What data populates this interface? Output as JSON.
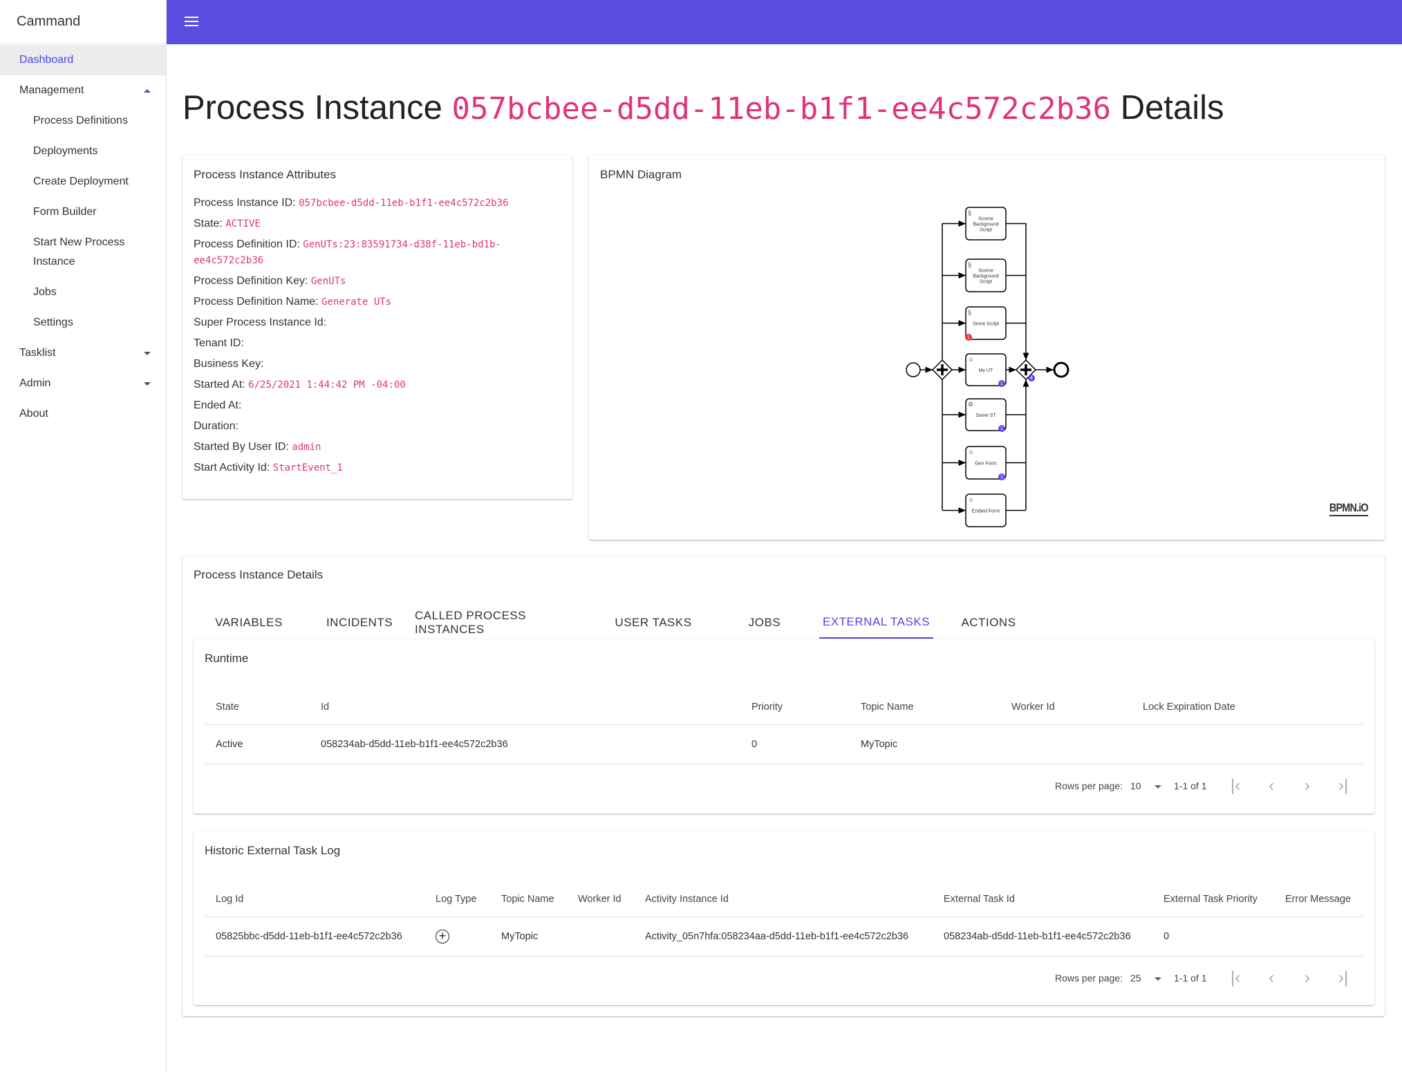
{
  "app": {
    "name": "Cammand",
    "header_color": "#5b4de0",
    "accent": "#4f46e5",
    "value_color": "#e0337a"
  },
  "sidebar": {
    "items": [
      {
        "label": "Dashboard",
        "active": true
      },
      {
        "label": "Management",
        "expanded": true
      },
      {
        "label": "Process Definitions"
      },
      {
        "label": "Deployments"
      },
      {
        "label": "Create Deployment"
      },
      {
        "label": "Form Builder"
      },
      {
        "label": "Start New Process"
      },
      {
        "label": "Instance"
      },
      {
        "label": "Jobs"
      },
      {
        "label": "Settings"
      },
      {
        "label": "Tasklist",
        "expanded": false
      },
      {
        "label": "Admin",
        "expanded": false
      },
      {
        "label": "About"
      }
    ]
  },
  "page": {
    "title_prefix": "Process Instance ",
    "title_id": "057bcbee-d5dd-11eb-b1f1-ee4c572c2b36",
    "title_suffix": " Details"
  },
  "attributes": {
    "title": "Process Instance Attributes",
    "rows": [
      {
        "label": "Process Instance ID: ",
        "value": "057bcbee-d5dd-11eb-b1f1-ee4c572c2b36"
      },
      {
        "label": "State: ",
        "value": "ACTIVE"
      },
      {
        "label": "Process Definition ID: ",
        "value": "GenUTs:23:83591734-d38f-11eb-bd1b-"
      },
      {
        "label": "",
        "value": "ee4c572c2b36"
      },
      {
        "label": "Process Definition Key: ",
        "value": "GenUTs"
      },
      {
        "label": "Process Definition Name: ",
        "value": "Generate UTs"
      },
      {
        "label": "Super Process Instance Id:",
        "value": ""
      },
      {
        "label": "Tenant ID:",
        "value": ""
      },
      {
        "label": "Business Key:",
        "value": ""
      },
      {
        "label": "Started At: ",
        "value": "6/25/2021 1:44:42 PM -04:00"
      },
      {
        "label": "Ended At:",
        "value": ""
      },
      {
        "label": "Duration:",
        "value": ""
      },
      {
        "label": "Started By User ID: ",
        "value": "admin"
      },
      {
        "label": "Start Activity Id: ",
        "value": "StartEvent_1"
      }
    ]
  },
  "bpmn": {
    "title": "BPMN Diagram",
    "logo": "BPMN.iO",
    "tasks": [
      {
        "name": "Scome Background Script",
        "type": "script"
      },
      {
        "name": "Scome Background Script",
        "type": "script"
      },
      {
        "name": "Some Script",
        "type": "script",
        "incident_badge": "1"
      },
      {
        "name": "My UT",
        "type": "user",
        "badge": "1"
      },
      {
        "name": "Some ST",
        "type": "service",
        "badge": "1"
      },
      {
        "name": "Gen Form",
        "type": "user",
        "badge": "1"
      },
      {
        "name": "Embed Form",
        "type": "user"
      }
    ],
    "join_badge": "4",
    "badge_color": "#5b4de0",
    "incident_color": "#e53935"
  },
  "details": {
    "title": "Process Instance Details",
    "tabs": [
      "VARIABLES",
      "INCIDENTS",
      "CALLED PROCESS INSTANCES",
      "USER TASKS",
      "JOBS",
      "EXTERNAL TASKS",
      "ACTIONS"
    ],
    "active_tab": "EXTERNAL TASKS",
    "runtime": {
      "title": "Runtime",
      "columns": [
        "State",
        "Id",
        "Priority",
        "Topic Name",
        "Worker Id",
        "Lock Expiration Date"
      ],
      "rows": [
        [
          "Active",
          "058234ab-d5dd-11eb-b1f1-ee4c572c2b36",
          "0",
          "MyTopic",
          "",
          ""
        ]
      ],
      "pagination": {
        "rows_label": "Rows per page:",
        "rows_value": "10",
        "range": "1-1 of 1"
      }
    },
    "historic": {
      "title": "Historic External Task Log",
      "columns": [
        "Log Id",
        "Log Type",
        "Topic Name",
        "Worker Id",
        "Activity Instance Id",
        "External Task Id",
        "External Task Priority",
        "Error Message"
      ],
      "rows": [
        [
          "05825bbc-d5dd-11eb-b1f1-ee4c572c2b36",
          "created-icon",
          "MyTopic",
          "",
          "Activity_05n7hfa:058234aa-d5dd-11eb-b1f1-ee4c572c2b36",
          "058234ab-d5dd-11eb-b1f1-ee4c572c2b36",
          "0",
          ""
        ]
      ],
      "pagination": {
        "rows_label": "Rows per page:",
        "rows_value": "25",
        "range": "1-1 of 1"
      }
    }
  }
}
